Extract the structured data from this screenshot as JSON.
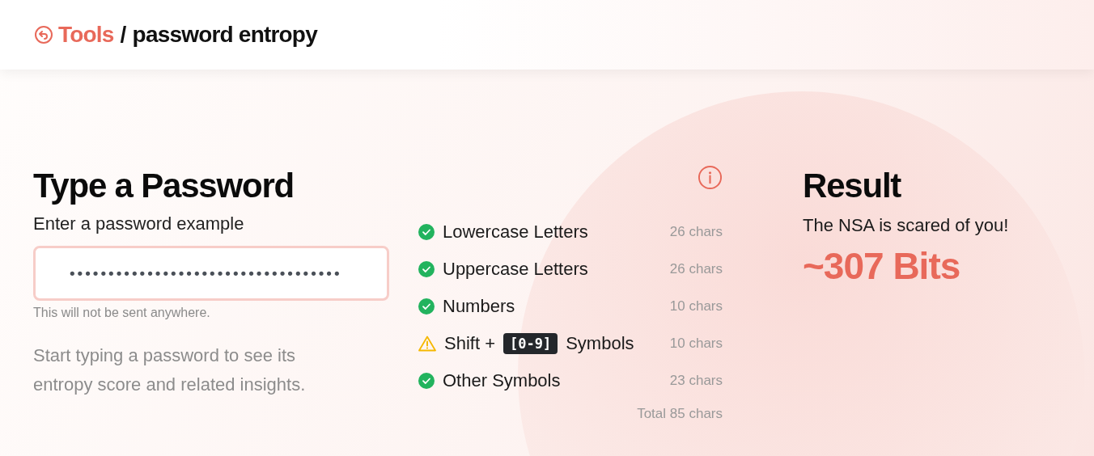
{
  "breadcrumb": {
    "link": "Tools",
    "separator": "/",
    "current": "password entropy"
  },
  "input_panel": {
    "title": "Type a Password",
    "label": "Enter a password example",
    "value": "•••••••••••••••••••••••••••••••••••",
    "hint": "This will not be sent anywhere.",
    "description": "Start typing a password to see its entropy score and related insights."
  },
  "charsets": [
    {
      "kind": "ok",
      "label": "Lowercase Letters",
      "count": "26 chars"
    },
    {
      "kind": "ok",
      "label": "Uppercase Letters",
      "count": "26 chars"
    },
    {
      "kind": "ok",
      "label": "Numbers",
      "count": "10 chars"
    },
    {
      "kind": "warn",
      "label": "Shift +",
      "key": "[0-9]",
      "label_after": "Symbols",
      "count": "10 chars"
    },
    {
      "kind": "ok",
      "label": "Other Symbols",
      "count": "23 chars"
    }
  ],
  "total": "Total 85 chars",
  "result": {
    "title": "Result",
    "message": "The NSA is scared of you!",
    "bits": "~307 Bits"
  }
}
